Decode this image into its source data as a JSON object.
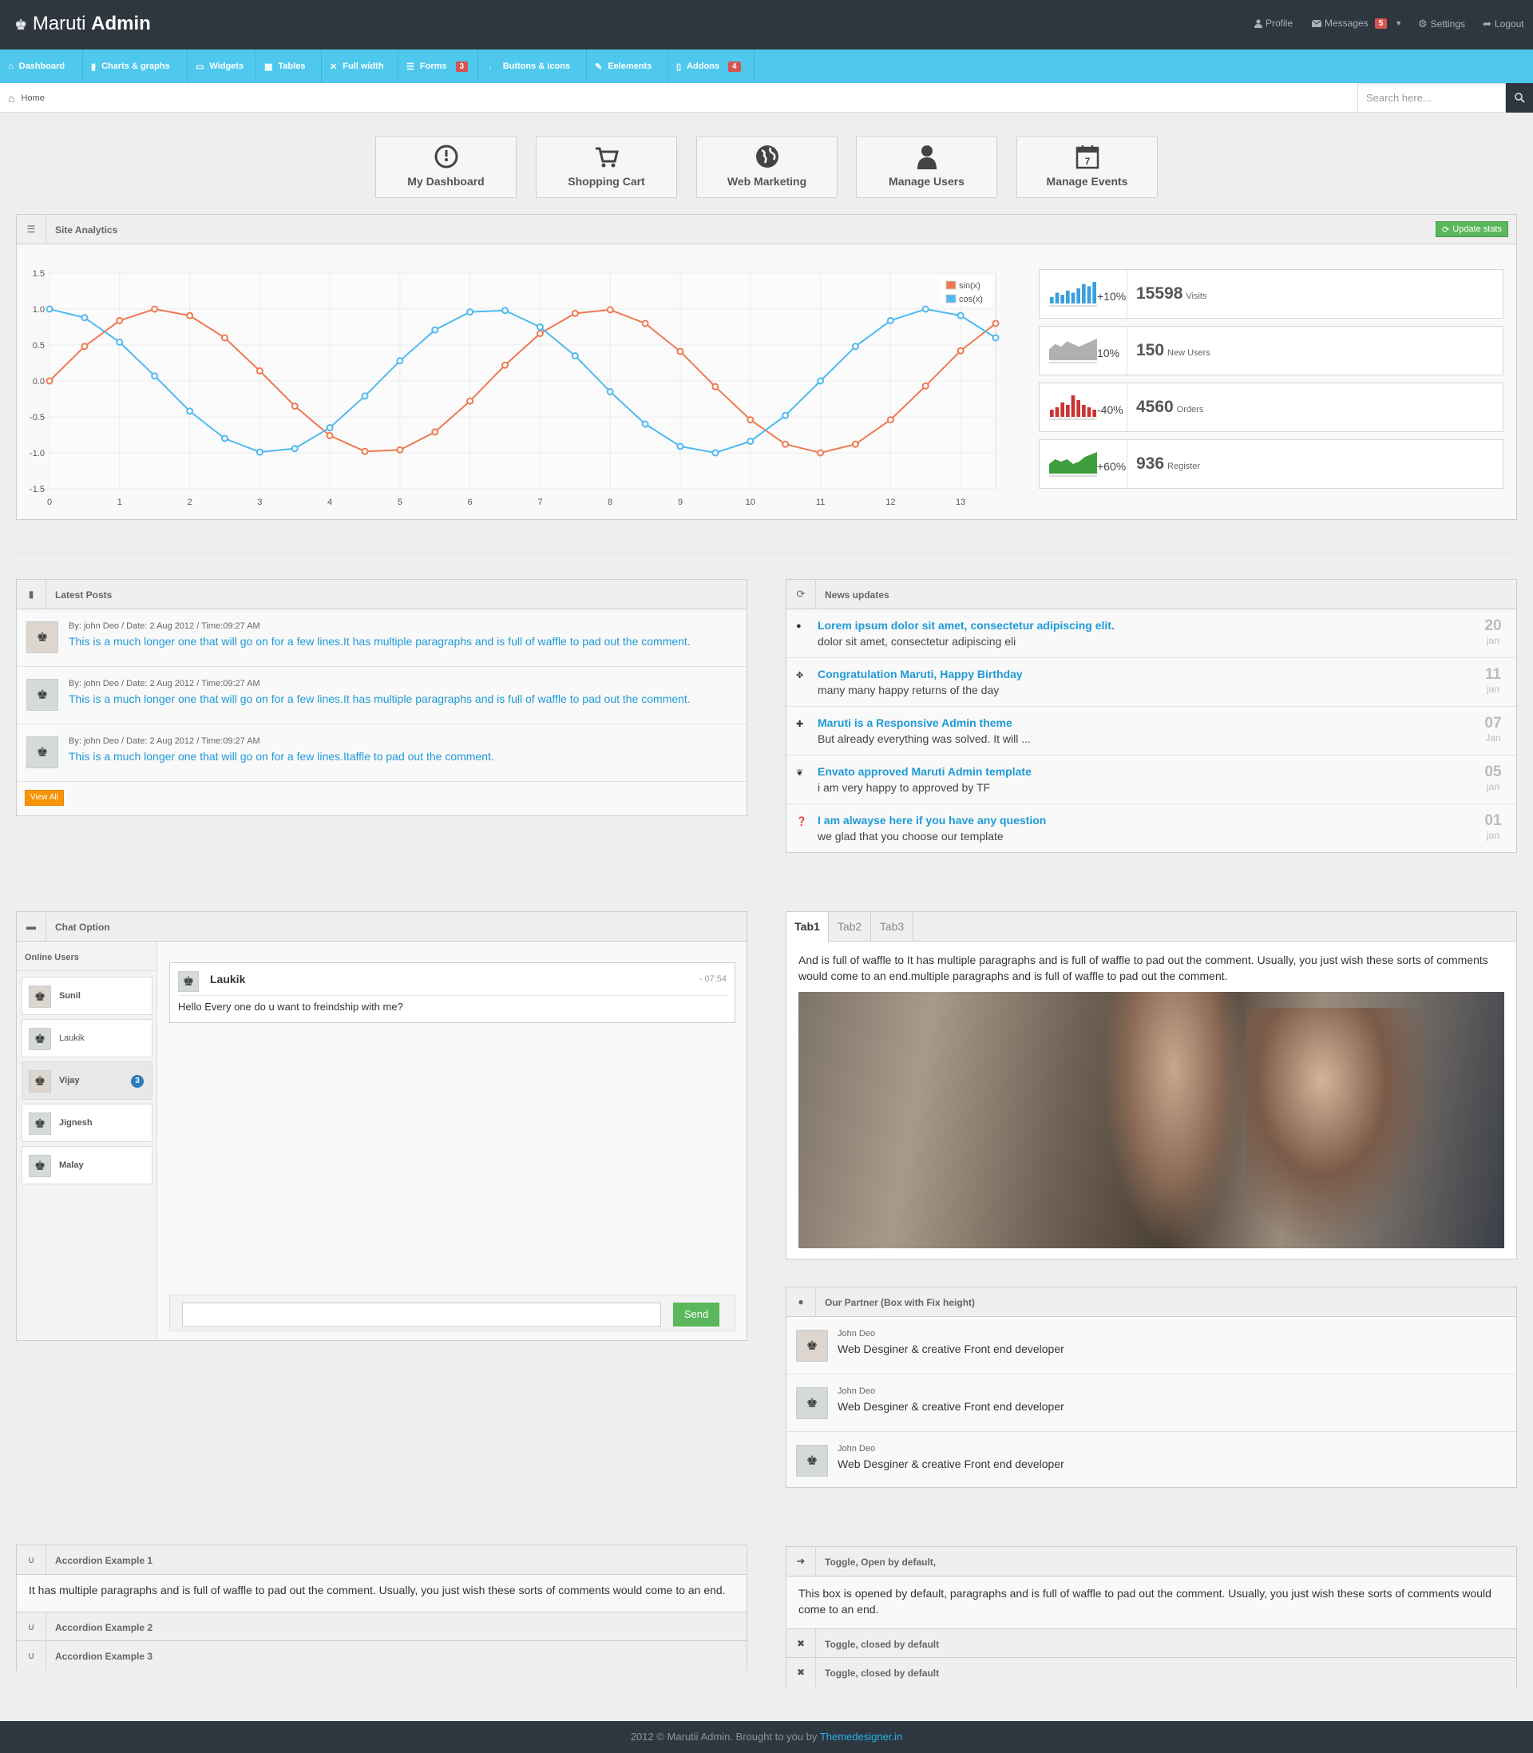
{
  "header": {
    "logo_text": "Maruti",
    "logo_bold": "Admin",
    "profile": "Profile",
    "messages": "Messages",
    "messages_count": "5",
    "settings": "Settings",
    "logout": "Logout"
  },
  "nav": [
    {
      "label": "Dashboard",
      "icon": "home-icon"
    },
    {
      "label": "Charts & graphs",
      "icon": "signal-icon"
    },
    {
      "label": "Widgets",
      "icon": "inbox-icon"
    },
    {
      "label": "Tables",
      "icon": "grid-icon"
    },
    {
      "label": "Full width",
      "icon": "fullscreen-icon"
    },
    {
      "label": "Forms",
      "icon": "list-icon",
      "badge": "3"
    },
    {
      "label": "Buttons & icons",
      "icon": "tint-icon"
    },
    {
      "label": "Eelements",
      "icon": "pencil-icon"
    },
    {
      "label": "Addons",
      "icon": "file-icon",
      "badge": "4"
    }
  ],
  "breadcrumb": {
    "home": "Home"
  },
  "search": {
    "placeholder": "Search here..."
  },
  "quick_buttons": [
    {
      "label": "My Dashboard",
      "icon": "dashboard-icon"
    },
    {
      "label": "Shopping Cart",
      "icon": "cart-icon"
    },
    {
      "label": "Web Marketing",
      "icon": "globe-icon"
    },
    {
      "label": "Manage Users",
      "icon": "user-icon"
    },
    {
      "label": "Manage Events",
      "icon": "calendar-icon",
      "calendar_day": "7"
    }
  ],
  "analytics": {
    "title": "Site Analytics",
    "update_button": "Update stats",
    "colors": {
      "sin": "#ee7951",
      "cos": "#4fb9f0"
    }
  },
  "chart_data": {
    "type": "line",
    "title": "",
    "xlabel": "",
    "ylabel": "",
    "xlim": [
      0,
      13.5
    ],
    "ylim": [
      -1.5,
      1.5
    ],
    "x_ticks": [
      "0",
      "1",
      "2",
      "3",
      "4",
      "5",
      "6",
      "7",
      "8",
      "9",
      "10",
      "11",
      "12",
      "13"
    ],
    "y_ticks": [
      "1.5",
      "1.0",
      "0.5",
      "0.0",
      "-0.5",
      "-1.0",
      "-1.5"
    ],
    "legend_position": "top-right",
    "grid": true,
    "x": [
      0,
      0.5,
      1,
      1.5,
      2,
      2.5,
      3,
      3.5,
      4,
      4.5,
      5,
      5.5,
      6,
      6.5,
      7,
      7.5,
      8,
      8.5,
      9,
      9.5,
      10,
      10.5,
      11,
      11.5,
      12,
      12.5,
      13,
      13.5
    ],
    "series": [
      {
        "name": "sin(x)",
        "values": [
          0,
          0.48,
          0.84,
          1.0,
          0.91,
          0.6,
          0.14,
          -0.35,
          -0.76,
          -0.98,
          -0.96,
          -0.71,
          -0.28,
          0.22,
          0.66,
          0.94,
          0.99,
          0.8,
          0.41,
          -0.08,
          -0.54,
          -0.88,
          -1.0,
          -0.88,
          -0.54,
          -0.07,
          0.42,
          0.8
        ]
      },
      {
        "name": "cos(x)",
        "values": [
          1.0,
          0.88,
          0.54,
          0.07,
          -0.42,
          -0.8,
          -0.99,
          -0.94,
          -0.65,
          -0.21,
          0.28,
          0.71,
          0.96,
          0.98,
          0.75,
          0.35,
          -0.15,
          -0.6,
          -0.91,
          -1.0,
          -0.84,
          -0.48,
          0.0,
          0.48,
          0.84,
          1.0,
          0.91,
          0.6
        ]
      }
    ]
  },
  "stats": [
    {
      "change": "+10%",
      "value": "15598",
      "label": "Visits",
      "color": "#3a9fdc",
      "spark": [
        3,
        5,
        4,
        6,
        5,
        7,
        9,
        8,
        10
      ]
    },
    {
      "change": "10%",
      "value": "150",
      "label": "New Users",
      "color": "#b0b0b0",
      "spark": [
        4,
        6,
        5,
        7,
        6,
        5,
        6,
        7,
        8
      ]
    },
    {
      "change": "-40%",
      "value": "4560",
      "label": "Orders",
      "color": "#cc3333",
      "spark": [
        3,
        4,
        6,
        5,
        9,
        7,
        5,
        4,
        3
      ]
    },
    {
      "change": "+60%",
      "value": "936",
      "label": "Register",
      "color": "#3f9f3f",
      "spark": [
        4,
        6,
        5,
        6,
        4,
        5,
        7,
        8,
        9
      ]
    }
  ],
  "latest_posts": {
    "title": "Latest Posts",
    "posts": [
      {
        "meta": "By: john Deo / Date: 2 Aug 2012 / Time:09:27 AM",
        "text": "This is a much longer one that will go on for a few lines.It has multiple paragraphs and is full of waffle to pad out the comment."
      },
      {
        "meta": "By: john Deo / Date: 2 Aug 2012 / Time:09:27 AM",
        "text": "This is a much longer one that will go on for a few lines.It has multiple paragraphs and is full of waffle to pad out the comment."
      },
      {
        "meta": "By: john Deo / Date: 2 Aug 2012 / Time:09:27 AM",
        "text": "This is a much longer one that will go on for a few lines.Itaffle to pad out the comment."
      }
    ],
    "view_all": "View All"
  },
  "news": {
    "title": "News updates",
    "items": [
      {
        "title": "Lorem ipsum dolor sit amet, consectetur adipiscing elit.",
        "desc": "dolor sit amet, consectetur adipiscing eli",
        "day": "20",
        "month": "jan",
        "icon": "ok-circle-icon"
      },
      {
        "title": "Congratulation Maruti, Happy Birthday",
        "desc": "many many happy returns of the day",
        "day": "11",
        "month": "jan",
        "icon": "gift-icon"
      },
      {
        "title": "Maruti is a Responsive Admin theme",
        "desc": "But already everything was solved. It will ...",
        "day": "07",
        "month": "Jan",
        "icon": "move-icon"
      },
      {
        "title": "Envato approved Maruti Admin template",
        "desc": "i am very happy to approved by TF",
        "day": "05",
        "month": "jan",
        "icon": "leaf-icon"
      },
      {
        "title": "I am alwayse here if you have any question",
        "desc": "we glad that you choose our template",
        "day": "01",
        "month": "jan",
        "icon": "question-icon"
      }
    ]
  },
  "chat": {
    "title": "Chat Option",
    "online_users_label": "Online Users",
    "users": [
      {
        "name": "Sunil"
      },
      {
        "name": "Laukik"
      },
      {
        "name": "Vijay",
        "badge": "3"
      },
      {
        "name": "Jignesh"
      },
      {
        "name": "Malay"
      }
    ],
    "message": {
      "author": "Laukik",
      "time": "- 07:54",
      "text": "Hello Every one do u want to freindship with me?"
    },
    "input_value": "",
    "send": "Send"
  },
  "tabs": {
    "labels": [
      "Tab1",
      "Tab2",
      "Tab3"
    ],
    "active": "Tab1",
    "content": "And is full of waffle to It has multiple paragraphs and is full of waffle to pad out the comment. Usually, you just wish these sorts of comments would come to an end.multiple paragraphs and is full of waffle to pad out the comment."
  },
  "partners": {
    "title": "Our Partner (Box with Fix height)",
    "items": [
      {
        "name": "John Deo",
        "role": "Web Desginer & creative Front end developer"
      },
      {
        "name": "John Deo",
        "role": "Web Desginer & creative Front end developer"
      },
      {
        "name": "John Deo",
        "role": "Web Desginer & creative Front end developer"
      }
    ]
  },
  "accordion": {
    "items": [
      {
        "title": "Accordion Example 1",
        "body": "It has multiple paragraphs and is full of waffle to pad out the comment. Usually, you just wish these sorts of comments would come to an end."
      },
      {
        "title": "Accordion Example 2"
      },
      {
        "title": "Accordion Example 3"
      }
    ]
  },
  "toggles": {
    "items": [
      {
        "title": "Toggle, Open by default,",
        "body": "This box is opened by default, paragraphs and is full of waffle to pad out the comment. Usually, you just wish these sorts of comments would come to an end."
      },
      {
        "title": "Toggle, closed by default"
      },
      {
        "title": "Toggle, closed by default"
      }
    ]
  },
  "footer": {
    "text": "2012 © Marutii Admin. Brought to you by ",
    "link": "Themedesigner.in"
  }
}
